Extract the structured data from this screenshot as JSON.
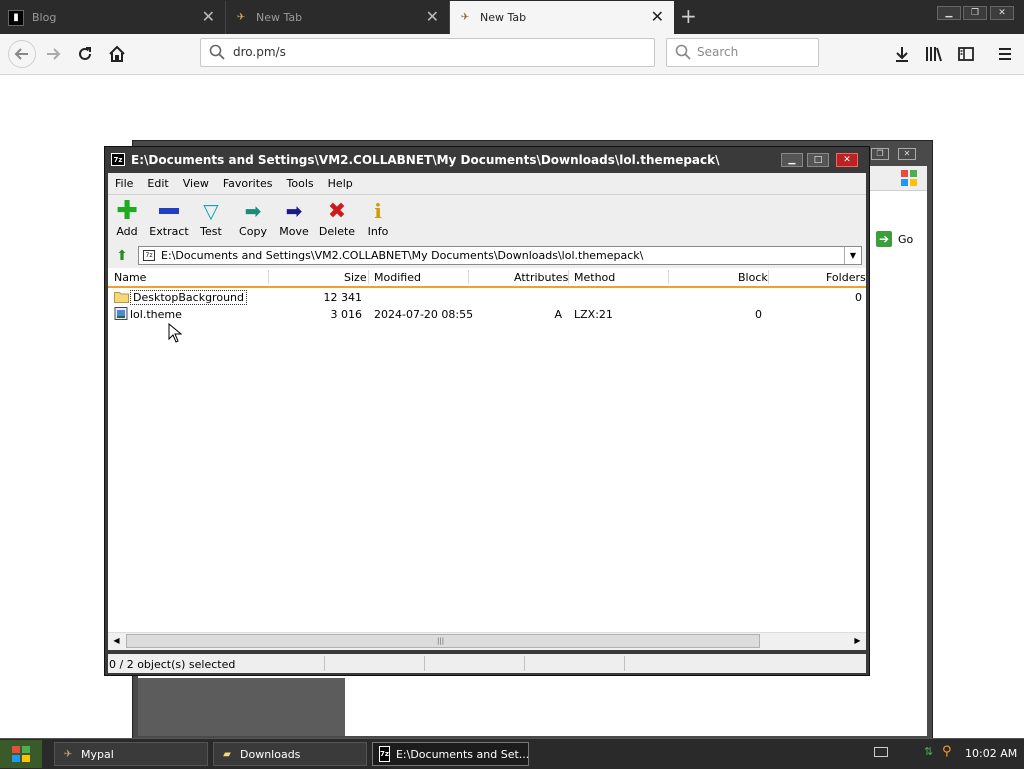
{
  "browser": {
    "tabs": [
      {
        "label": "Blog",
        "active": false
      },
      {
        "label": "New Tab",
        "active": false
      },
      {
        "label": "New Tab",
        "active": true
      }
    ],
    "url": "dro.pm/s",
    "search_placeholder": "Search"
  },
  "background_window": {
    "go_label": "Go"
  },
  "zip_window": {
    "title": "E:\\Documents and Settings\\VM2.COLLABNET\\My Documents\\Downloads\\lol.themepack\\",
    "menu": [
      "File",
      "Edit",
      "View",
      "Favorites",
      "Tools",
      "Help"
    ],
    "toolbar": [
      {
        "label": "Add",
        "icon": "add-icon"
      },
      {
        "label": "Extract",
        "icon": "extract-icon"
      },
      {
        "label": "Test",
        "icon": "test-icon"
      },
      {
        "label": "Copy",
        "icon": "copy-icon"
      },
      {
        "label": "Move",
        "icon": "move-icon"
      },
      {
        "label": "Delete",
        "icon": "delete-icon"
      },
      {
        "label": "Info",
        "icon": "info-icon"
      }
    ],
    "address": "E:\\Documents and Settings\\VM2.COLLABNET\\My Documents\\Downloads\\lol.themepack\\",
    "columns": [
      "Name",
      "Size",
      "Modified",
      "Attributes",
      "Method",
      "Block",
      "Folders"
    ],
    "rows": [
      {
        "type": "folder",
        "name": "DesktopBackground",
        "size": "12 341",
        "modified": "",
        "attributes": "",
        "method": "",
        "block": "",
        "folders": "0"
      },
      {
        "type": "file",
        "name": "lol.theme",
        "size": "3 016",
        "modified": "2024-07-20 08:55",
        "attributes": "A",
        "method": "LZX:21",
        "block": "0",
        "folders": ""
      }
    ],
    "status": "0 / 2 object(s) selected"
  },
  "taskbar": {
    "items": [
      {
        "label": "Mypal",
        "active": false
      },
      {
        "label": "Downloads",
        "active": false
      },
      {
        "label": "E:\\Documents and Set...",
        "active": true
      }
    ],
    "clock": "10:02 AM"
  },
  "colors": {
    "tabstrip": "#2b2b2b",
    "column_underline": "#f0a030",
    "taskbar": "#2a2a2a"
  }
}
